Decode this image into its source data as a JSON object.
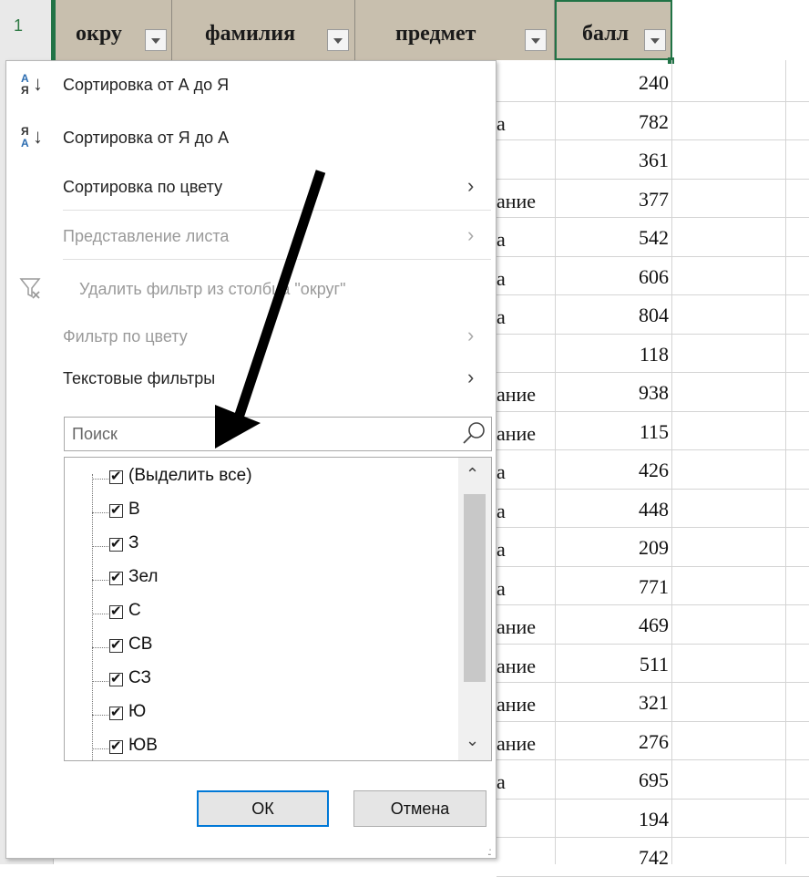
{
  "spreadsheet": {
    "row_number": "1",
    "headers": [
      {
        "label": "окру"
      },
      {
        "label": "фамилия"
      },
      {
        "label": "предмет"
      },
      {
        "label": "балл"
      }
    ],
    "rows": [
      {
        "subject_fragment": "",
        "score": "240"
      },
      {
        "subject_fragment": "а",
        "score": "782"
      },
      {
        "subject_fragment": "",
        "score": "361"
      },
      {
        "subject_fragment": "ание",
        "score": "377"
      },
      {
        "subject_fragment": "а",
        "score": "542"
      },
      {
        "subject_fragment": "а",
        "score": "606"
      },
      {
        "subject_fragment": "а",
        "score": "804"
      },
      {
        "subject_fragment": "",
        "score": "118"
      },
      {
        "subject_fragment": "ание",
        "score": "938"
      },
      {
        "subject_fragment": "ание",
        "score": "115"
      },
      {
        "subject_fragment": "а",
        "score": "426"
      },
      {
        "subject_fragment": "а",
        "score": "448"
      },
      {
        "subject_fragment": "а",
        "score": "209"
      },
      {
        "subject_fragment": "а",
        "score": "771"
      },
      {
        "subject_fragment": "ание",
        "score": "469"
      },
      {
        "subject_fragment": "ание",
        "score": "511"
      },
      {
        "subject_fragment": "ание",
        "score": "321"
      },
      {
        "subject_fragment": "ание",
        "score": "276"
      },
      {
        "subject_fragment": "а",
        "score": "695"
      },
      {
        "subject_fragment": "",
        "score": "194"
      },
      {
        "subject_fragment": "",
        "score": "742"
      }
    ]
  },
  "filter_menu": {
    "sort_asc": "Сортировка от А до Я",
    "sort_desc": "Сортировка от Я до А",
    "sort_by_color": "Сортировка по цвету",
    "sheet_view": "Представление листа",
    "clear_filter": "Удалить фильтр из столбца \"округ\"",
    "filter_by_color": "Фильтр по цвету",
    "text_filters": "Текстовые фильтры",
    "search_placeholder": "Поиск",
    "list_items": [
      "(Выделить все)",
      "В",
      "З",
      "Зел",
      "С",
      "СВ",
      "СЗ",
      "Ю",
      "ЮВ"
    ],
    "ok_label": "ОК",
    "cancel_label": "Отмена"
  },
  "colors": {
    "accent": "#217346",
    "header_fill": "#c8bfae",
    "button_focus": "#0078d7"
  }
}
